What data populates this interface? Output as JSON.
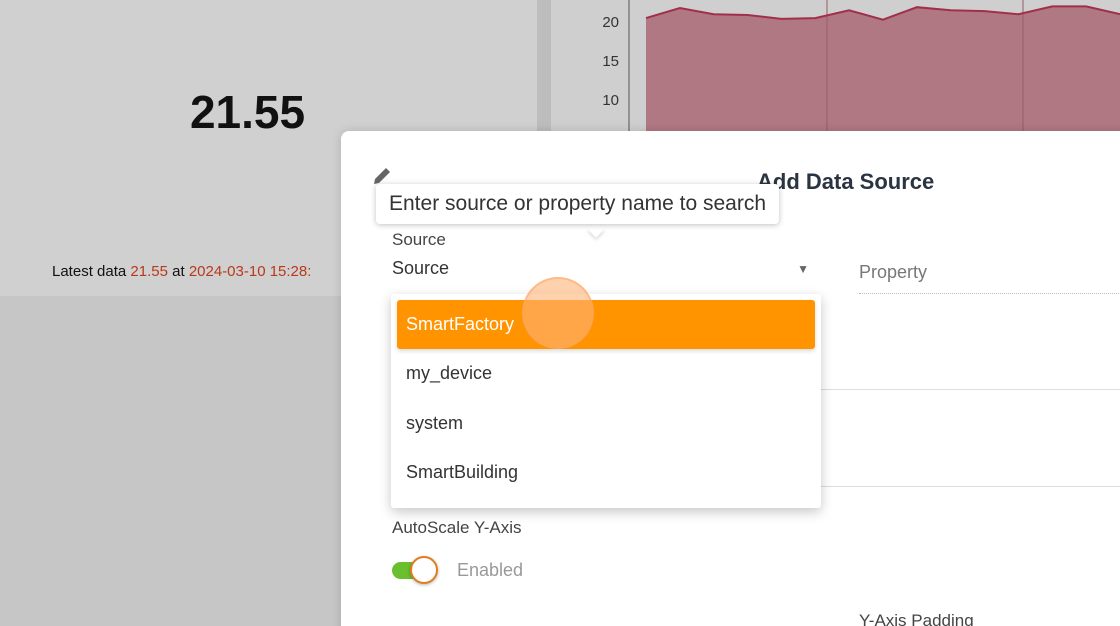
{
  "dashboard": {
    "value_widget": {
      "value": "21.55",
      "latest_prefix": "Latest data",
      "latest_value": "21.55",
      "latest_at": "at",
      "latest_time": "2024-03-10 15:28:"
    },
    "chart_widget": {
      "chart_data": {
        "type": "area",
        "y_ticks": [
          "20",
          "15",
          "10"
        ],
        "values": [
          20.5,
          21.8,
          21.0,
          20.9,
          20.4,
          20.5,
          21.5,
          20.3,
          21.9,
          21.5,
          21.4,
          21.0,
          22.0,
          22.0,
          21.0
        ],
        "series_color": "#a0304a",
        "fill_color": "#b07883"
      }
    }
  },
  "modal": {
    "title": "Add Data Source",
    "tooltip": "Enter source or property name to search",
    "source_label": "Source",
    "source_value": "Source",
    "property_placeholder": "Property",
    "autoscale_label": "AutoScale Y-Axis",
    "autoscale_state": "Enabled",
    "ypadding_label": "Y-Axis Padding"
  },
  "dropdown": {
    "options": [
      "SmartFactory",
      "my_device",
      "system",
      "SmartBuilding"
    ],
    "active_color": "#ff9400"
  }
}
